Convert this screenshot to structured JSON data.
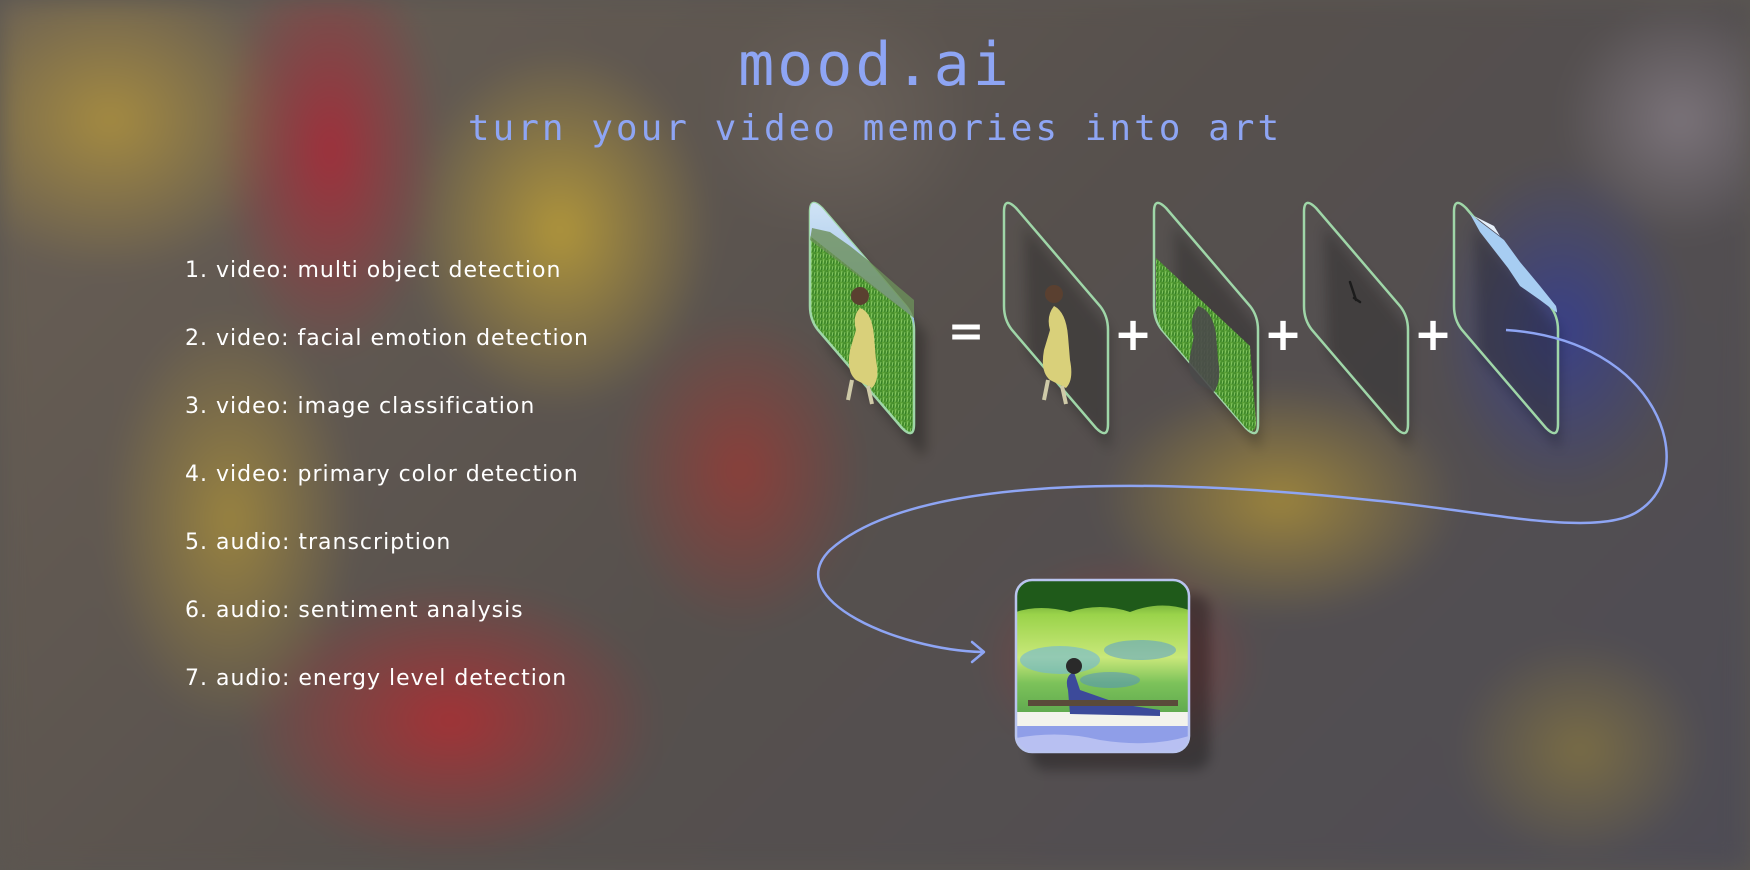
{
  "title": "mood.ai",
  "subtitle": "turn your video memories into art",
  "features": [
    {
      "num": "1.",
      "label": "video: multi object detection"
    },
    {
      "num": "2.",
      "label": "video: facial emotion detection"
    },
    {
      "num": "3.",
      "label": "video: image classification"
    },
    {
      "num": "4.",
      "label": "video: primary color detection"
    },
    {
      "num": "5.",
      "label": "audio: transcription"
    },
    {
      "num": "6.",
      "label": "audio: sentiment analysis"
    },
    {
      "num": "7.",
      "label": "audio: energy level detection"
    }
  ],
  "operators": [
    "=",
    "+",
    "+",
    "+"
  ],
  "colors": {
    "accent": "#8ea5f4",
    "frame_border": "#9fd6a8",
    "text": "#ffffff"
  }
}
